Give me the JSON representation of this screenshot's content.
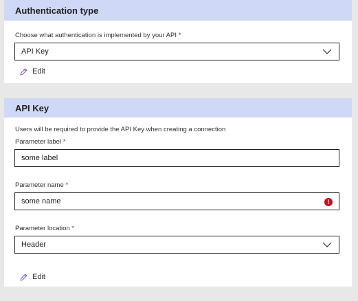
{
  "auth_section": {
    "title": "Authentication type",
    "field_label": "Choose what authentication is implemented by your API",
    "required_mark": "*",
    "selected_value": "API Key",
    "edit_label": "Edit"
  },
  "apikey_section": {
    "title": "API Key",
    "description": "Users will be required to provide the API Key when creating a connection",
    "param_label": {
      "label": "Parameter label",
      "required_mark": "*",
      "value": "some label"
    },
    "param_name": {
      "label": "Parameter name",
      "required_mark": "*",
      "value": "some name",
      "error_icon": "!"
    },
    "param_location": {
      "label": "Parameter location",
      "required_mark": "*",
      "selected_value": "Header"
    },
    "edit_label": "Edit"
  },
  "colors": {
    "header_bg": "#cfd8f7",
    "error": "#c50f1f",
    "edit_icon": "#8661c5"
  },
  "icons": {
    "dropdown": "chevron-down-icon",
    "edit": "pencil-icon",
    "error": "error-icon"
  }
}
